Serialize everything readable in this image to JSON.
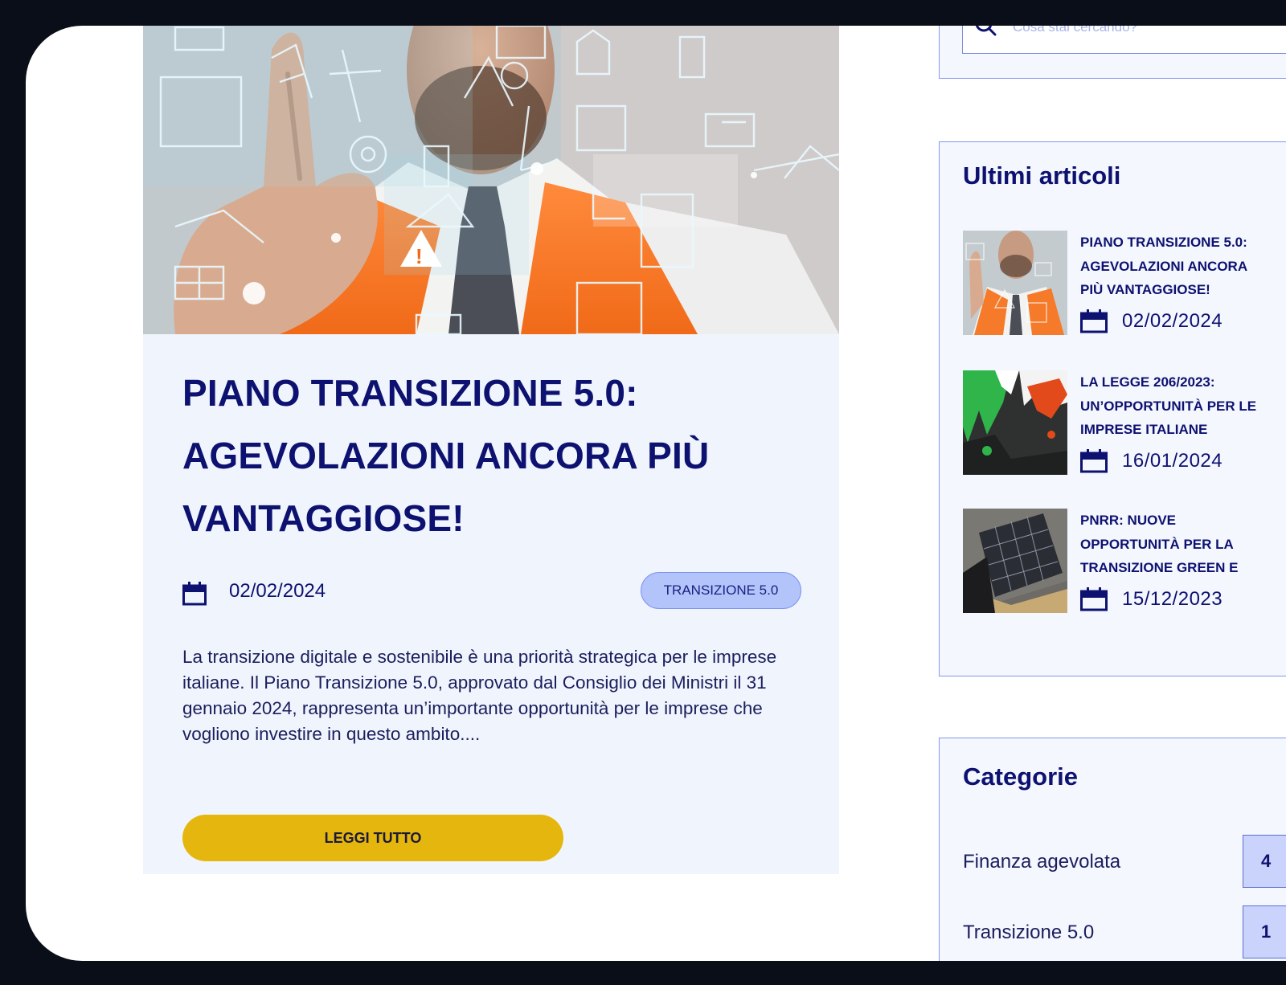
{
  "article": {
    "title_line1": "PIANO TRANSIZIONE 5.0:",
    "title_line2": "AGEVOLAZIONI ANCORA PIÙ",
    "title_line3": "VANTAGGIOSE!",
    "date": "02/02/2024",
    "tag": "TRANSIZIONE 5.0",
    "excerpt": "La transizione digitale e sostenibile è una priorità strategica per le imprese italiane. Il Piano Transizione 5.0, approvato dal Consiglio dei Ministri il 31 gennaio 2024, rappresenta un’importante opportunità per le imprese che vogliono investire in questo ambito....",
    "read_more_label": "LEGGI TUTTO",
    "hero_icon": "construction-tech-hero-image"
  },
  "search": {
    "placeholder": "Cosa stai cercando?",
    "icon": "search-icon"
  },
  "recent": {
    "heading": "Ultimi articoli",
    "items": [
      {
        "title_lines": [
          "PIANO TRANSIZIONE 5.0:",
          "AGEVOLAZIONI ANCORA",
          "PIÙ VANTAGGIOSE!"
        ],
        "date": "02/02/2024"
      },
      {
        "title_lines": [
          "LA LEGGE 206/2023:",
          "UN’OPPORTUNITÀ PER LE",
          "IMPRESE ITALIANE"
        ],
        "date": "16/01/2024"
      },
      {
        "title_lines": [
          "PNRR: NUOVE",
          "OPPORTUNITÀ PER LA",
          "TRANSIZIONE GREEN E"
        ],
        "date": "15/12/2023"
      }
    ]
  },
  "categories": {
    "heading": "Categorie",
    "items": [
      {
        "label": "Finanza agevolata",
        "count": "4"
      },
      {
        "label": "Transizione 5.0",
        "count": "1"
      }
    ]
  },
  "colors": {
    "primary": "#0d1170",
    "accent_button": "#e5b60d",
    "tag_bg": "#b3c4fb",
    "card_bg": "#f0f5fd"
  }
}
